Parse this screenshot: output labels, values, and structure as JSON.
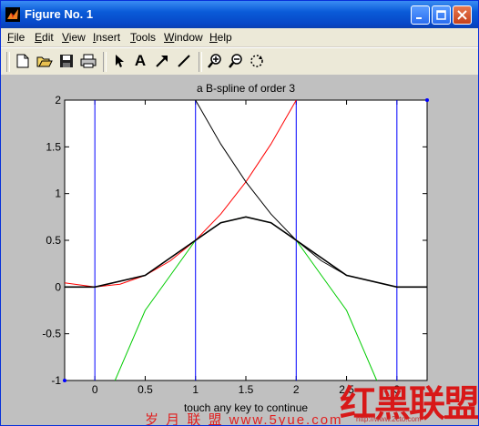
{
  "window": {
    "title": "Figure No. 1",
    "controls": [
      "minimize",
      "maximize",
      "close"
    ]
  },
  "menubar": {
    "items": [
      {
        "label": "File",
        "accel": "F",
        "rest": "ile"
      },
      {
        "label": "Edit",
        "accel": "E",
        "rest": "dit"
      },
      {
        "label": "View",
        "accel": "V",
        "rest": "iew"
      },
      {
        "label": "Insert",
        "accel": "I",
        "rest": "nsert"
      },
      {
        "label": "Tools",
        "accel": "T",
        "rest": "ools"
      },
      {
        "label": "Window",
        "accel": "W",
        "rest": "indow"
      },
      {
        "label": "Help",
        "accel": "H",
        "rest": "elp"
      }
    ]
  },
  "toolbar": {
    "buttons": [
      "new-file-icon",
      "open-folder-icon",
      "save-icon",
      "print-icon",
      "select-arrow-icon",
      "text-A-icon",
      "arrow-icon",
      "line-icon",
      "zoom-in-icon",
      "zoom-out-icon",
      "rotate-icon"
    ],
    "text_tool_glyph": "A"
  },
  "chart_data": {
    "type": "line",
    "title": "a B-spline of order 3",
    "xlabel": "touch any key to continue",
    "ylabel": "",
    "xlim": [
      -0.3,
      3.3
    ],
    "ylim": [
      -1,
      2
    ],
    "xticks": [
      "0",
      "0.5",
      "1",
      "1.5",
      "2",
      "2.5",
      "3"
    ],
    "yticks": [
      "-1",
      "-0.5",
      "0",
      "0.5",
      "1",
      "1.5",
      "2"
    ],
    "knots": [
      0,
      1,
      2,
      3
    ],
    "series": [
      {
        "color": "#ff0000",
        "x": [
          -0.3,
          0,
          0.25,
          0.5,
          0.75,
          1,
          1.25,
          1.5,
          1.75,
          2
        ],
        "y": [
          0.045,
          0,
          0.031,
          0.125,
          0.281,
          0.5,
          0.781,
          1.125,
          1.531,
          2
        ]
      },
      {
        "color": "#00cc00",
        "x": [
          0.2,
          0.5,
          0.75,
          1,
          1.25,
          1.5,
          1.75,
          2,
          2.25,
          2.5,
          2.8
        ],
        "y": [
          -1,
          -0.25,
          0.125,
          0.5,
          0.688,
          0.75,
          0.688,
          0.5,
          0.125,
          -0.25,
          -1
        ]
      },
      {
        "color": "#000000",
        "x": [
          -0.3,
          0,
          0.5,
          1,
          1.25,
          1.5,
          1.75,
          2,
          2.5,
          3,
          3.3
        ],
        "y": [
          0,
          0,
          0.125,
          0.5,
          0.688,
          0.75,
          0.688,
          0.5,
          0.125,
          0,
          0
        ]
      },
      {
        "color": "#000000",
        "x": [
          1,
          1.25,
          1.5,
          1.75,
          2,
          2.25,
          2.5
        ],
        "y": [
          2,
          1.531,
          1.125,
          0.781,
          0.5,
          0.281,
          0.125
        ]
      }
    ],
    "vlines": {
      "color": "#0000ff",
      "x": [
        0,
        1,
        2,
        3
      ]
    },
    "grid": false
  },
  "watermark": {
    "cn_text": "岁 月 联 盟   www.5yue.com",
    "big_text": "红黑联盟",
    "url": "http://www.2cto.com"
  }
}
